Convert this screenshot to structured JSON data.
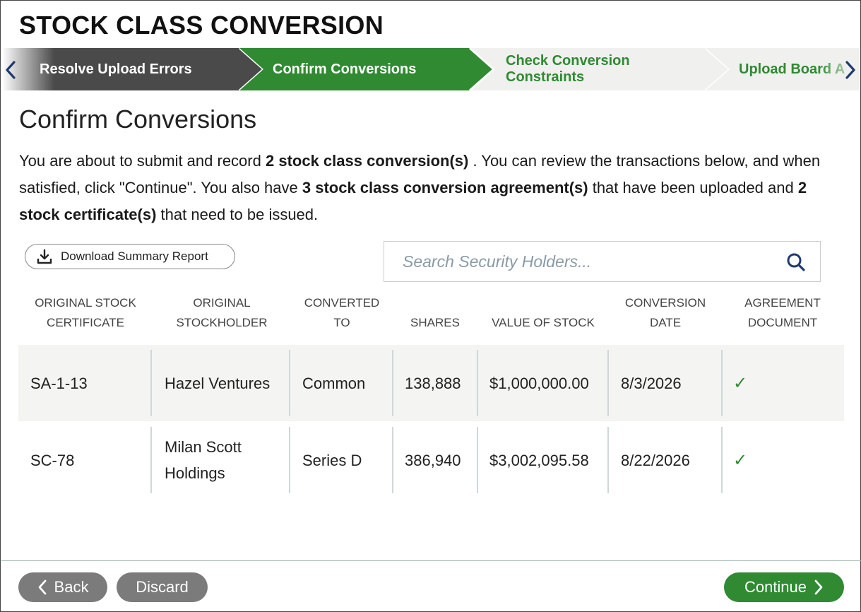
{
  "app": {
    "title": "STOCK CLASS CONVERSION"
  },
  "stepper": {
    "steps": [
      {
        "label": "Resolve Upload Errors",
        "state": "completed"
      },
      {
        "label": "Confirm Conversions",
        "state": "active"
      },
      {
        "label": "Check Conversion Constraints",
        "state": "upcoming"
      },
      {
        "label": "Upload Board A",
        "state": "upcoming"
      }
    ]
  },
  "main": {
    "section_title": "Confirm Conversions",
    "intro": {
      "p1": "You are about to submit and record ",
      "b1": "2 stock class conversion(s)",
      "p2": " . You can review the transactions below, and when satisfied, click \"Continue\". You also have ",
      "b2": "3 stock class conversion agreement(s)",
      "p3": " that have been uploaded and ",
      "b3": "2 stock certificate(s)",
      "p4": " that need to be issued."
    },
    "download_label": "Download Summary Report",
    "search_placeholder": "Search Security Holders..."
  },
  "table": {
    "headers": {
      "certificate": "ORIGINAL STOCK CERTIFICATE",
      "stockholder": "ORIGINAL STOCKHOLDER",
      "converted_to": "CONVERTED TO",
      "shares": "SHARES",
      "value": "VALUE OF STOCK",
      "date": "CONVERSION DATE",
      "agreement": "AGREEMENT DOCUMENT"
    },
    "rows": [
      {
        "certificate": "SA-1-13",
        "stockholder": "Hazel Ventures",
        "converted_to": "Common",
        "shares": "138,888",
        "value": "$1,000,000.00",
        "date": "8/3/2026",
        "agreement": "✓"
      },
      {
        "certificate": "SC-78",
        "stockholder": "Milan Scott Holdings",
        "converted_to": "Series D",
        "shares": "386,940",
        "value": "$3,002,095.58",
        "date": "8/22/2026",
        "agreement": "✓"
      }
    ]
  },
  "footer": {
    "back_label": "Back",
    "discard_label": "Discard",
    "continue_label": "Continue"
  },
  "colors": {
    "accent_green": "#2f8a32",
    "step_completed": "#4a4a4a",
    "step_upcoming": "#f0f0ee",
    "button_gray": "#7b7b7b",
    "icon_navy": "#1f3a6e"
  },
  "icons": {
    "prev": "chevron-left-icon",
    "next": "chevron-right-icon",
    "download": "download-icon",
    "search": "search-icon",
    "check": "check-icon"
  }
}
